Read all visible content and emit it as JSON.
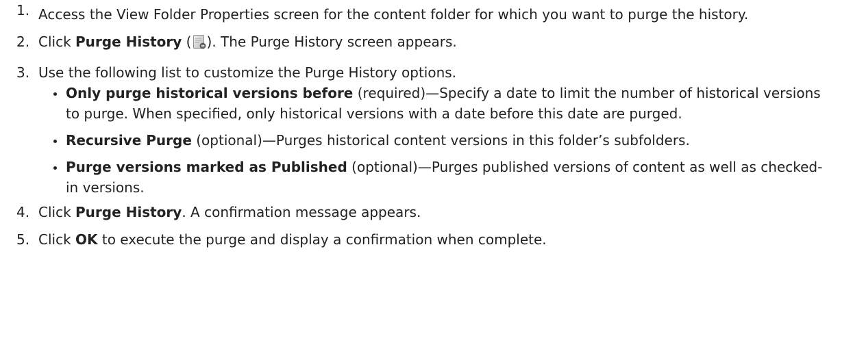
{
  "steps": [
    {
      "number": "1.",
      "text": "Access the View Folder Properties screen for the content folder for which you want to purge the history."
    },
    {
      "number": "2.",
      "prefix": "Click ",
      "bold": "Purge History",
      "icon_open": " (",
      "icon": "purge-history-icon",
      "icon_close": ")",
      "suffix": ". The Purge History screen appears."
    },
    {
      "number": "3.",
      "text": "Use the following list to customize the Purge History options.",
      "options": [
        {
          "bold": "Only purge historical versions before",
          "text": " (required)—Specify a date to limit the number of historical versions to purge. When specified, only historical versions with a date before this date are purged."
        },
        {
          "bold": "Recursive Purge",
          "text": " (optional)—Purges historical content versions in this folder’s subfolders."
        },
        {
          "bold": "Purge versions marked as Published",
          "text": " (optional)—Purges published versions of content as well as checked-in versions."
        }
      ]
    },
    {
      "number": "4.",
      "prefix": "Click ",
      "bold": "Purge History",
      "suffix": ". A confirmation message appears."
    },
    {
      "number": "5.",
      "prefix": "Click ",
      "bold": "OK",
      "suffix": " to execute the purge and display a confirmation when complete."
    }
  ]
}
